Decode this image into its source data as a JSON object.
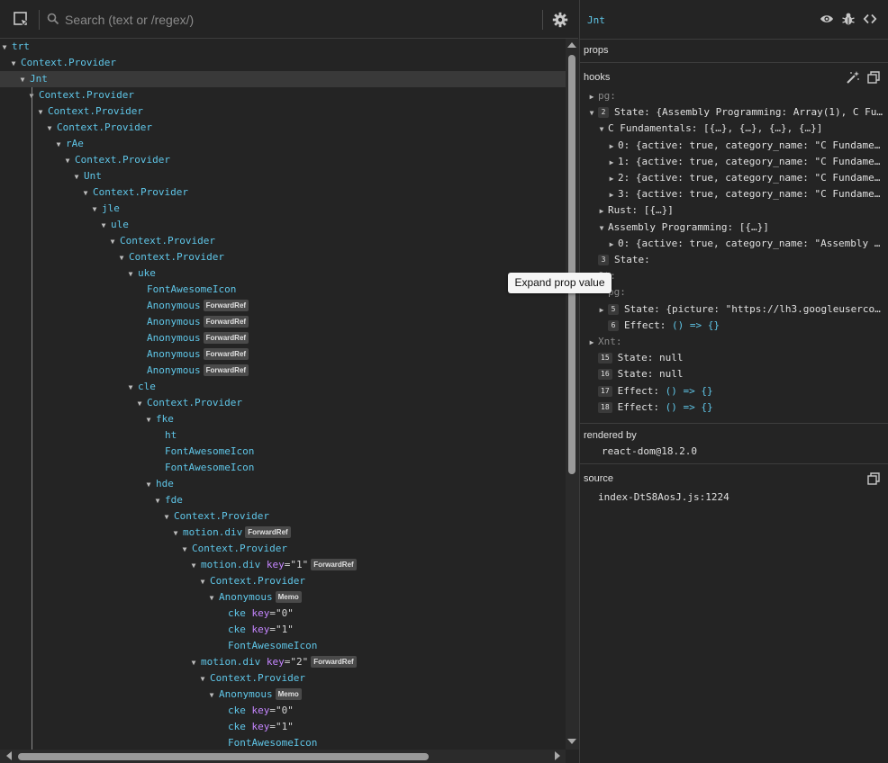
{
  "search": {
    "placeholder": "Search (text or /regex/)"
  },
  "tree": [
    {
      "depth": 0,
      "name": "trt",
      "arrow": "down"
    },
    {
      "depth": 1,
      "name": "Context.Provider",
      "arrow": "down"
    },
    {
      "depth": 2,
      "name": "Jnt",
      "arrow": "down",
      "selected": true
    },
    {
      "depth": 3,
      "name": "Context.Provider",
      "arrow": "down"
    },
    {
      "depth": 4,
      "name": "Context.Provider",
      "arrow": "down"
    },
    {
      "depth": 5,
      "name": "Context.Provider",
      "arrow": "down"
    },
    {
      "depth": 6,
      "name": "rAe",
      "arrow": "down"
    },
    {
      "depth": 7,
      "name": "Context.Provider",
      "arrow": "down"
    },
    {
      "depth": 8,
      "name": "Unt",
      "arrow": "down"
    },
    {
      "depth": 9,
      "name": "Context.Provider",
      "arrow": "down"
    },
    {
      "depth": 10,
      "name": "jle",
      "arrow": "down"
    },
    {
      "depth": 11,
      "name": "ule",
      "arrow": "down"
    },
    {
      "depth": 12,
      "name": "Context.Provider",
      "arrow": "down"
    },
    {
      "depth": 13,
      "name": "Context.Provider",
      "arrow": "down"
    },
    {
      "depth": 14,
      "name": "uke",
      "arrow": "down"
    },
    {
      "depth": 15,
      "name": "FontAwesomeIcon",
      "arrow": ""
    },
    {
      "depth": 15,
      "name": "Anonymous",
      "arrow": "",
      "badge": "ForwardRef"
    },
    {
      "depth": 15,
      "name": "Anonymous",
      "arrow": "",
      "badge": "ForwardRef"
    },
    {
      "depth": 15,
      "name": "Anonymous",
      "arrow": "",
      "badge": "ForwardRef"
    },
    {
      "depth": 15,
      "name": "Anonymous",
      "arrow": "",
      "badge": "ForwardRef"
    },
    {
      "depth": 15,
      "name": "Anonymous",
      "arrow": "",
      "badge": "ForwardRef"
    },
    {
      "depth": 14,
      "name": "cle",
      "arrow": "down"
    },
    {
      "depth": 15,
      "name": "Context.Provider",
      "arrow": "down"
    },
    {
      "depth": 16,
      "name": "fke",
      "arrow": "down"
    },
    {
      "depth": 17,
      "name": "ht",
      "arrow": ""
    },
    {
      "depth": 17,
      "name": "FontAwesomeIcon",
      "arrow": ""
    },
    {
      "depth": 17,
      "name": "FontAwesomeIcon",
      "arrow": ""
    },
    {
      "depth": 16,
      "name": "hde",
      "arrow": "down"
    },
    {
      "depth": 17,
      "name": "fde",
      "arrow": "down"
    },
    {
      "depth": 18,
      "name": "Context.Provider",
      "arrow": "down"
    },
    {
      "depth": 19,
      "name": "motion.div",
      "arrow": "down",
      "badge": "ForwardRef"
    },
    {
      "depth": 20,
      "name": "Context.Provider",
      "arrow": "down"
    },
    {
      "depth": 21,
      "name": "motion.div",
      "arrow": "down",
      "key": "\"1\"",
      "badge": "ForwardRef"
    },
    {
      "depth": 22,
      "name": "Context.Provider",
      "arrow": "down"
    },
    {
      "depth": 23,
      "name": "Anonymous",
      "arrow": "down",
      "badge": "Memo"
    },
    {
      "depth": 24,
      "name": "cke",
      "arrow": "",
      "key": "\"0\""
    },
    {
      "depth": 24,
      "name": "cke",
      "arrow": "",
      "key": "\"1\""
    },
    {
      "depth": 24,
      "name": "FontAwesomeIcon",
      "arrow": ""
    },
    {
      "depth": 21,
      "name": "motion.div",
      "arrow": "down",
      "key": "\"2\"",
      "badge": "ForwardRef"
    },
    {
      "depth": 22,
      "name": "Context.Provider",
      "arrow": "down"
    },
    {
      "depth": 23,
      "name": "Anonymous",
      "arrow": "down",
      "badge": "Memo"
    },
    {
      "depth": 24,
      "name": "cke",
      "arrow": "",
      "key": "\"0\""
    },
    {
      "depth": 24,
      "name": "cke",
      "arrow": "",
      "key": "\"1\""
    },
    {
      "depth": 24,
      "name": "FontAwesomeIcon",
      "arrow": ""
    }
  ],
  "key_label": "key",
  "right": {
    "component": "Jnt",
    "props_label": "props",
    "hooks_label": "hooks",
    "rendered_by_label": "rendered by",
    "rendered_by_value": "react-dom@18.2.0",
    "source_label": "source",
    "source_value": "index-DtS8AosJ.js:1224"
  },
  "hooks": [
    {
      "indent": 0,
      "arrow": "right",
      "num": "",
      "key": "pg:",
      "val": "",
      "grayKey": true
    },
    {
      "indent": 0,
      "arrow": "down",
      "num": "2",
      "key": "State:",
      "val": "{Assembly Programming: Array(1), C Fu…"
    },
    {
      "indent": 1,
      "arrow": "down",
      "num": "",
      "key": "C Fundamentals:",
      "val": "[{…}, {…}, {…}, {…}]"
    },
    {
      "indent": 2,
      "arrow": "right",
      "num": "",
      "key": "0:",
      "val": "{active: true, category_name: \"C Fundame…"
    },
    {
      "indent": 2,
      "arrow": "right",
      "num": "",
      "key": "1:",
      "val": "{active: true, category_name: \"C Fundame…"
    },
    {
      "indent": 2,
      "arrow": "right",
      "num": "",
      "key": "2:",
      "val": "{active: true, category_name: \"C Fundame…"
    },
    {
      "indent": 2,
      "arrow": "right",
      "num": "",
      "key": "3:",
      "val": "{active: true, category_name: \"C Fundame…"
    },
    {
      "indent": 1,
      "arrow": "right",
      "num": "",
      "key": "Rust:",
      "val": "[{…}]"
    },
    {
      "indent": 1,
      "arrow": "down",
      "num": "",
      "key": "Assembly Programming:",
      "val": "[{…}]"
    },
    {
      "indent": 2,
      "arrow": "right",
      "num": "",
      "key": "0:",
      "val": "{active: true, category_name: \"Assembly …"
    },
    {
      "indent": 0,
      "arrow": "",
      "num": "3",
      "key": "State:",
      "val": ""
    },
    {
      "indent": 0,
      "arrow": "",
      "num": "",
      "key": "Ot:",
      "val": "",
      "grayKey": true
    },
    {
      "indent": 1,
      "arrow": "",
      "num": "",
      "key": "pg:",
      "val": "",
      "grayKey": true
    },
    {
      "indent": 1,
      "arrow": "right",
      "num": "5",
      "key": "State:",
      "val": "{picture: \"https://lh3.googleuserco…"
    },
    {
      "indent": 1,
      "arrow": "",
      "num": "6",
      "key": "Effect:",
      "val": "() => {}",
      "fn": true
    },
    {
      "indent": 0,
      "arrow": "right",
      "num": "",
      "key": "Xnt:",
      "val": "",
      "grayKey": true
    },
    {
      "indent": 0,
      "arrow": "",
      "num": "15",
      "key": "State:",
      "val": "null"
    },
    {
      "indent": 0,
      "arrow": "",
      "num": "16",
      "key": "State:",
      "val": "null"
    },
    {
      "indent": 0,
      "arrow": "",
      "num": "17",
      "key": "Effect:",
      "val": "() => {}",
      "fn": true
    },
    {
      "indent": 0,
      "arrow": "",
      "num": "18",
      "key": "Effect:",
      "val": "() => {}",
      "fn": true
    }
  ],
  "tooltip": "Expand prop value",
  "icons": {
    "select": "inspect-element-icon",
    "search": "search-icon",
    "settings": "gear-icon",
    "eye": "eye-icon",
    "bug": "bug-icon",
    "code": "code-icon",
    "wand": "magic-wand-icon",
    "copy": "copy-icon"
  }
}
